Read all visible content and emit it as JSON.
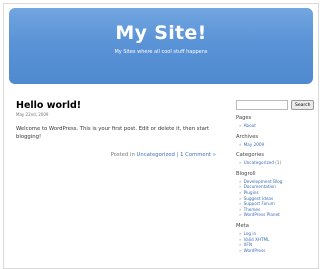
{
  "header": {
    "title": "My Site!",
    "description": "My Sites where all cool stuff happens"
  },
  "post": {
    "title": "Hello world!",
    "date": "May 22nd, 2009",
    "body": "Welcome to WordPress. This is your first post. Edit or delete it, then start blogging!",
    "meta_prefix": "Posted in",
    "category": "Uncategorized",
    "separator": "|",
    "comments": "1 Comment »"
  },
  "sidebar": {
    "search": {
      "value": "",
      "button_label": "Search"
    },
    "pages": {
      "heading": "Pages",
      "items": [
        "About"
      ]
    },
    "archives": {
      "heading": "Archives",
      "items": [
        "May 2009"
      ]
    },
    "categories": {
      "heading": "Categories",
      "items": [
        {
          "label": "Uncategorized",
          "count": "(1)"
        }
      ]
    },
    "blogroll": {
      "heading": "Blogroll",
      "items": [
        "Development Blog",
        "Documentation",
        "Plugins",
        "Suggest Ideas",
        "Support Forum",
        "Themes",
        "WordPress Planet"
      ]
    },
    "meta": {
      "heading": "Meta",
      "items": [
        "Log in",
        "Valid XHTML",
        "XFN",
        "WordPress"
      ]
    }
  },
  "colors": {
    "header_blue": "#5a93d6",
    "link": "#3e6fb7"
  }
}
